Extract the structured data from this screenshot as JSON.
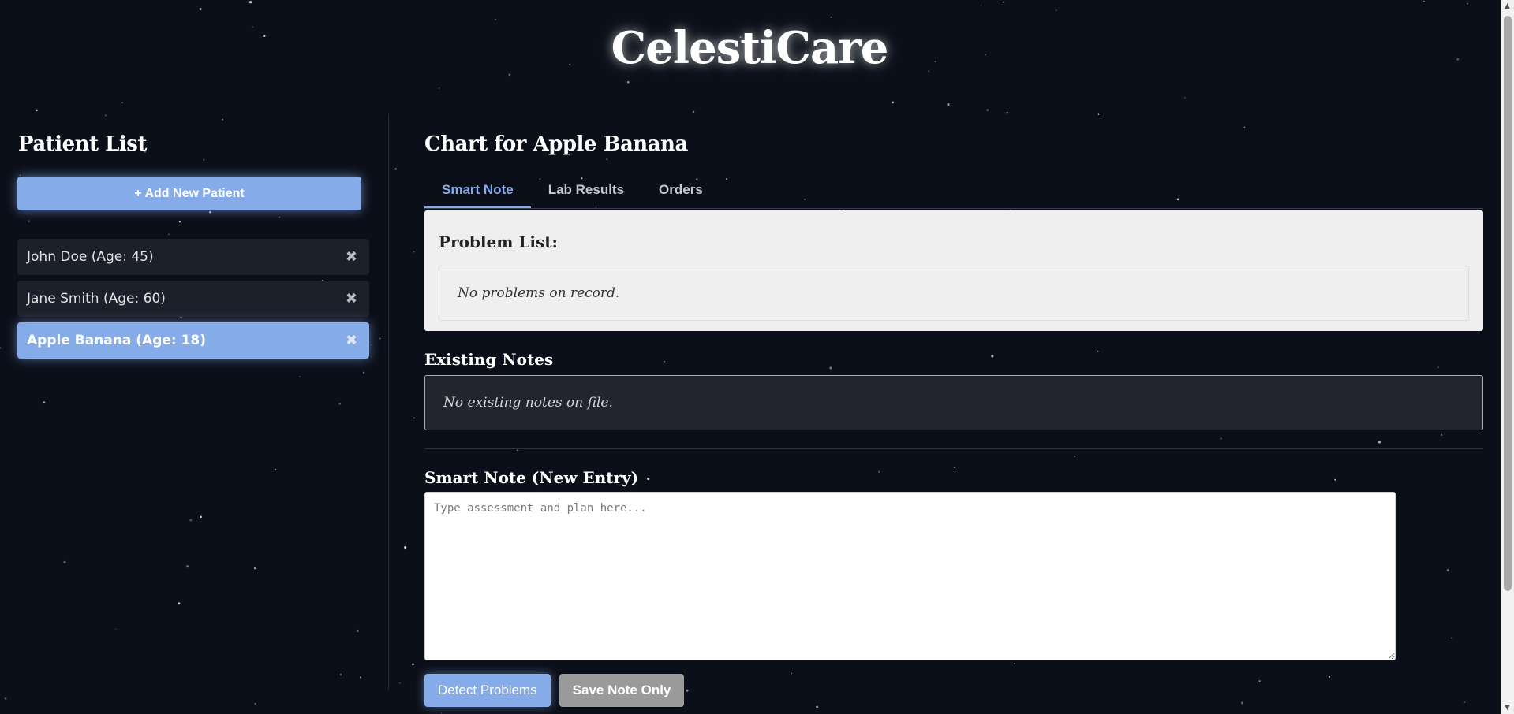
{
  "app": {
    "title": "CelestiCare"
  },
  "sidebar": {
    "heading": "Patient List",
    "add_button_label": "+ Add New Patient",
    "remove_glyph": "✖",
    "patients": [
      {
        "label": "John Doe (Age: 45)",
        "selected": false
      },
      {
        "label": "Jane Smith (Age: 60)",
        "selected": false
      },
      {
        "label": "Apple Banana (Age: 18)",
        "selected": true
      }
    ]
  },
  "main": {
    "chart_title": "Chart for Apple Banana",
    "tabs": [
      {
        "label": "Smart Note",
        "active": true
      },
      {
        "label": "Lab Results",
        "active": false
      },
      {
        "label": "Orders",
        "active": false
      }
    ],
    "problem_list": {
      "heading": "Problem List:",
      "empty_text": "No problems on record."
    },
    "existing_notes": {
      "heading": "Existing Notes",
      "empty_text": "No existing notes on file."
    },
    "smart_note": {
      "heading": "Smart Note (New Entry)",
      "placeholder": "Type assessment and plan here...",
      "value": ""
    },
    "actions": {
      "detect_label": "Detect Problems",
      "save_label": "Save Note Only"
    }
  },
  "colors": {
    "background": "#0b0f19",
    "accent": "#85abe8",
    "secondary_button": "#9a9a9a",
    "panel_light": "#efefef",
    "panel_dark": "#22252e"
  },
  "icons": {
    "remove": "close-icon",
    "resize": "resize-handle-icon",
    "scroll_up": "chevron-up-icon",
    "scroll_down": "chevron-down-icon"
  }
}
